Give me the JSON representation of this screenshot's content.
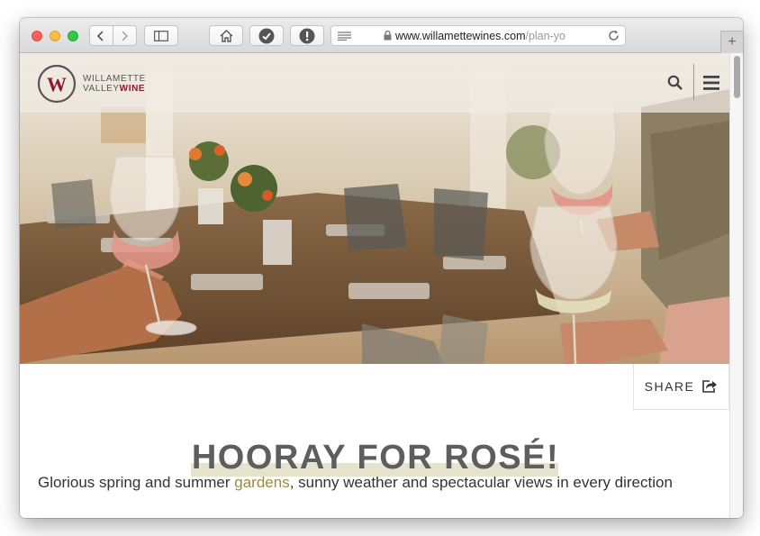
{
  "browser": {
    "url_domain": "www.willamettewines.com",
    "url_path": "/plan-yo",
    "new_tab_symbol": "+"
  },
  "site": {
    "logo_line1": "WILLAMETTE",
    "logo_line2_a": "VALLEY",
    "logo_line2_b": "WINE",
    "logo_monogram": "W",
    "brand_color": "#8a1c2b"
  },
  "share": {
    "label": "SHARE"
  },
  "article": {
    "title": "HOORAY FOR ROSÉ!",
    "intro_before": "Glorious spring and summer ",
    "intro_link": "gardens",
    "intro_after": ", sunny weather and spectacular views in every direction"
  },
  "icons": [
    "home-icon",
    "checkmark-icon",
    "alert-icon",
    "reader-icon",
    "lock-icon",
    "reload-icon",
    "search-icon",
    "menu-icon",
    "share-icon"
  ]
}
